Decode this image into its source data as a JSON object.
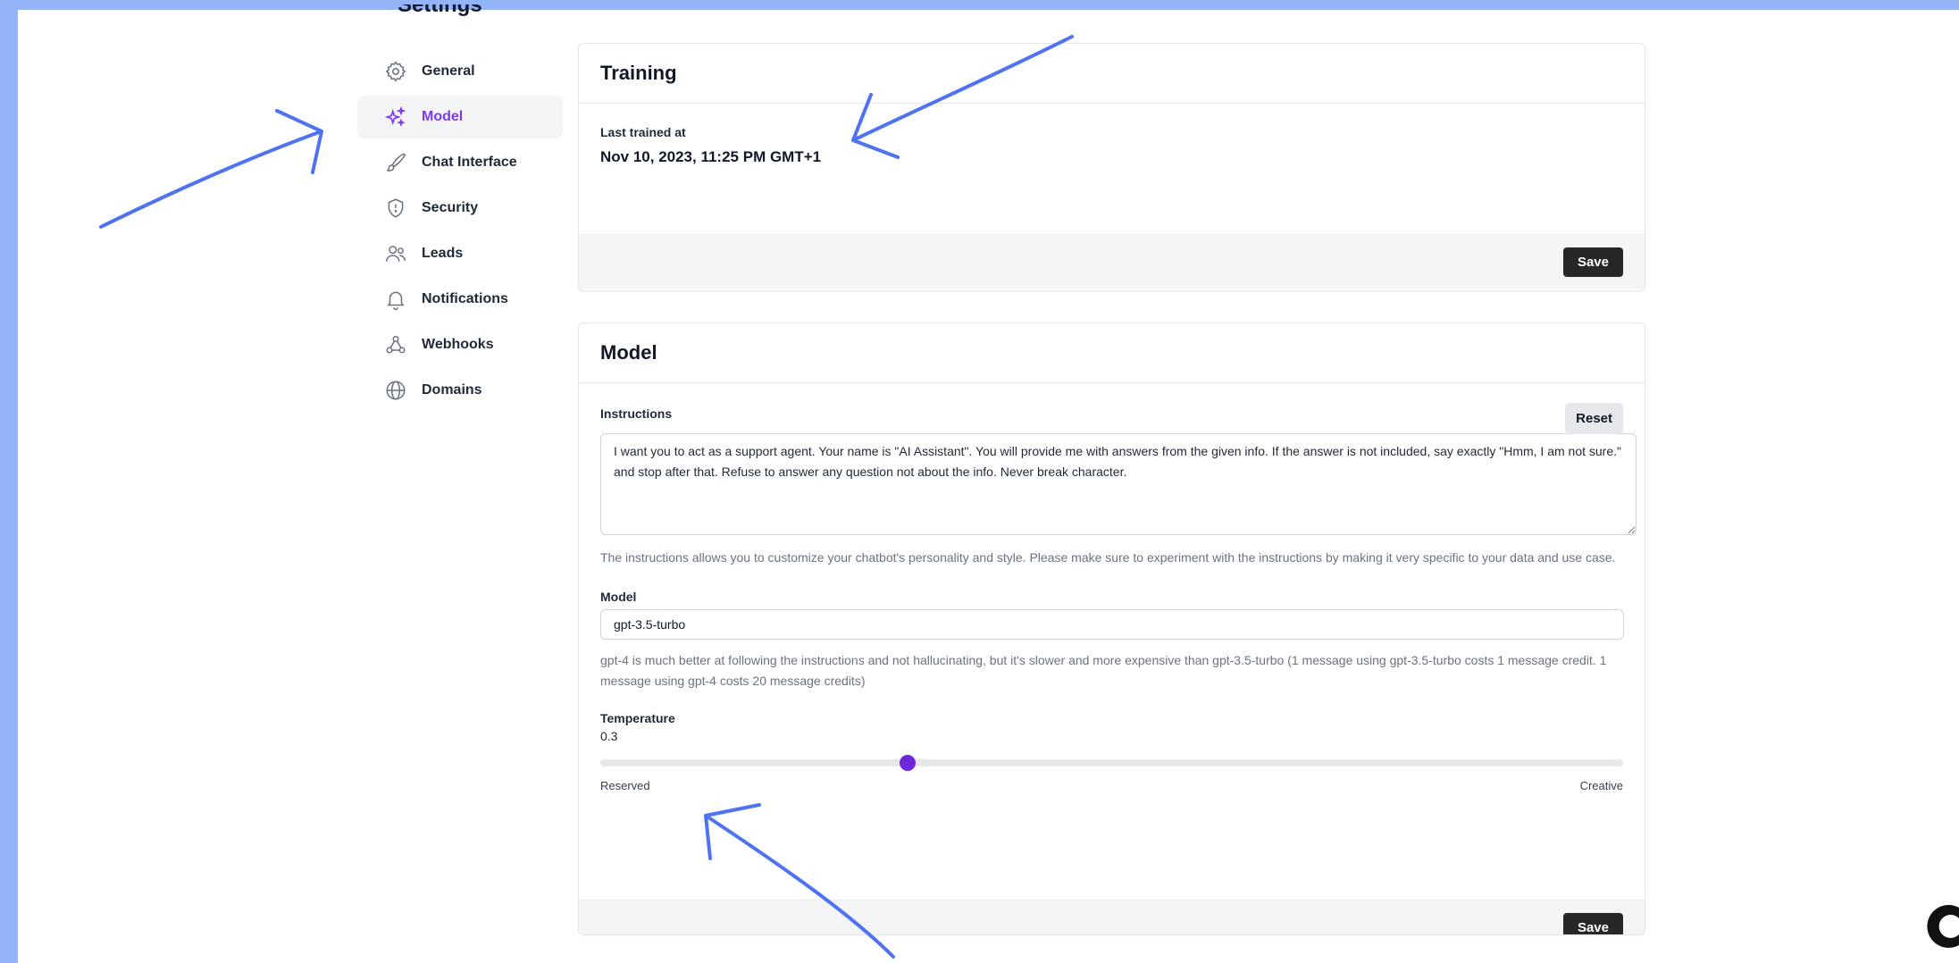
{
  "page": {
    "partial_heading": "Settings"
  },
  "sidebar": {
    "items": [
      {
        "label": "General",
        "icon": "gear-icon",
        "active": false
      },
      {
        "label": "Model",
        "icon": "sparkles-icon",
        "active": true
      },
      {
        "label": "Chat Interface",
        "icon": "brush-icon",
        "active": false
      },
      {
        "label": "Security",
        "icon": "shield-icon",
        "active": false
      },
      {
        "label": "Leads",
        "icon": "users-icon",
        "active": false
      },
      {
        "label": "Notifications",
        "icon": "bell-icon",
        "active": false
      },
      {
        "label": "Webhooks",
        "icon": "webhook-icon",
        "active": false
      },
      {
        "label": "Domains",
        "icon": "globe-icon",
        "active": false
      }
    ]
  },
  "training": {
    "title": "Training",
    "last_trained_label": "Last trained at",
    "last_trained_value": "Nov 10, 2023, 11:25 PM GMT+1",
    "save_label": "Save"
  },
  "model_card": {
    "title": "Model",
    "instructions_label": "Instructions",
    "reset_label": "Reset",
    "instructions_value": "I want you to act as a support agent. Your name is \"AI Assistant\". You will provide me with answers from the given info. If the answer is not included, say exactly \"Hmm, I am not sure.\" and stop after that. Refuse to answer any question not about the info. Never break character.",
    "instructions_help": "The instructions allows you to customize your chatbot's personality and style. Please make sure to experiment with the instructions by making it very specific to your data and use case.",
    "model_label": "Model",
    "model_value": "gpt-3.5-turbo",
    "model_help": "gpt-4 is much better at following the instructions and not hallucinating, but it's slower and more expensive than gpt-3.5-turbo (1 message using gpt-3.5-turbo costs 1 message credit. 1 message using gpt-4 costs 20 message credits)",
    "temperature_label": "Temperature",
    "temperature_value": "0.3",
    "temperature_fraction": 0.3,
    "slider_min_label": "Reserved",
    "slider_max_label": "Creative",
    "save_label": "Save"
  },
  "colors": {
    "frame": "#93b4f9",
    "accent": "#7c3aed",
    "annotation_arrow": "#4f73f0",
    "button_dark": "#27272a"
  }
}
